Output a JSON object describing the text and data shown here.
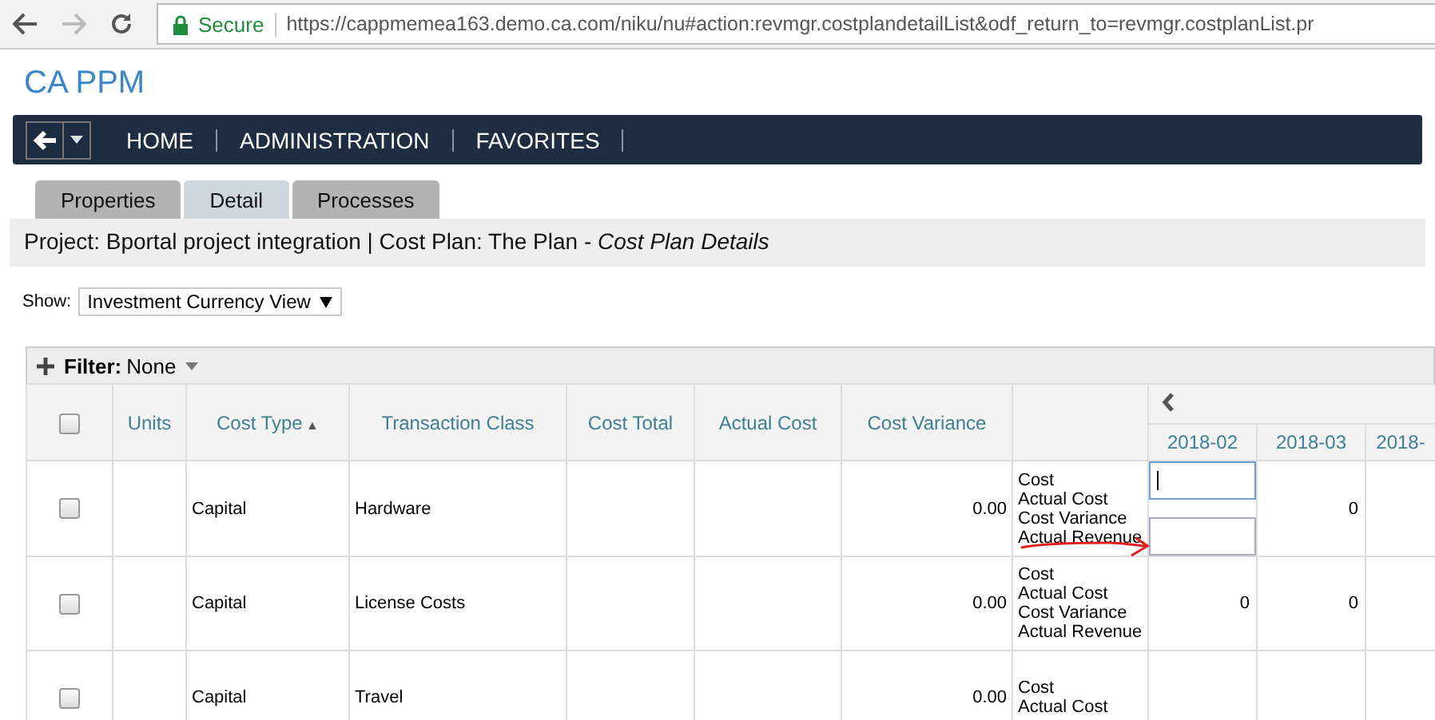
{
  "browser": {
    "security": "Secure",
    "url": "https://cappmemea163.demo.ca.com/niku/nu#action:revmgr.costplandetailList&odf_return_to=revmgr.costplanList.pr"
  },
  "app_title": "CA PPM",
  "nav": {
    "items": [
      "HOME",
      "ADMINISTRATION",
      "FAVORITES"
    ]
  },
  "tabs": [
    {
      "label": "Properties",
      "selected": false
    },
    {
      "label": "Detail",
      "selected": true
    },
    {
      "label": "Processes",
      "selected": false
    }
  ],
  "page_heading": "Project: Bportal project integration | Cost Plan: The Plan - *Cost Plan Details*",
  "show": {
    "label": "Show:",
    "value": "Investment Currency View"
  },
  "filter": {
    "label": "Filter:",
    "value": "None"
  },
  "table": {
    "header_checked": false,
    "columns": [
      {
        "label": "Units"
      },
      {
        "label": "Cost Type",
        "sort_indicator": "▲"
      },
      {
        "label": "Transaction Class"
      },
      {
        "label": "Cost Total"
      },
      {
        "label": "Actual Cost"
      },
      {
        "label": "Cost Variance"
      }
    ],
    "periods": [
      "2018-02",
      "2018-03",
      "2018-"
    ],
    "rows": [
      {
        "checked": false,
        "units": "",
        "cost_type": "Capital",
        "transaction_class": "Hardware",
        "cost_total": "",
        "actual_cost": "",
        "cost_variance": "0.00",
        "metrics": [
          "Cost",
          "Actual Cost",
          "Cost Variance",
          "Actual Revenue"
        ],
        "period_cells": [
          {
            "kind": "inputs",
            "fields": [
              {
                "focused": true
              },
              {
                "focused": false
              }
            ]
          },
          {
            "kind": "value",
            "value": "0"
          },
          {
            "kind": "empty"
          }
        ]
      },
      {
        "checked": false,
        "units": "",
        "cost_type": "Capital",
        "transaction_class": "License Costs",
        "cost_total": "",
        "actual_cost": "",
        "cost_variance": "0.00",
        "metrics": [
          "Cost",
          "Actual Cost",
          "Cost Variance",
          "Actual Revenue"
        ],
        "period_cells": [
          {
            "kind": "value",
            "value": "0"
          },
          {
            "kind": "value",
            "value": "0"
          },
          {
            "kind": "empty"
          }
        ]
      },
      {
        "checked": false,
        "units": "",
        "cost_type": "Capital",
        "transaction_class": "Travel",
        "cost_total": "",
        "actual_cost": "",
        "cost_variance": "0.00",
        "metrics": [
          "Cost",
          "Actual Cost"
        ],
        "period_cells": [
          {
            "kind": "empty"
          },
          {
            "kind": "empty"
          },
          {
            "kind": "empty"
          }
        ]
      }
    ]
  }
}
